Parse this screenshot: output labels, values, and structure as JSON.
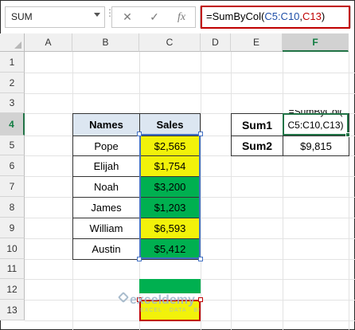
{
  "formula_bar": {
    "name_box": "SUM",
    "cancel_glyph": "✕",
    "enter_glyph": "✓",
    "fx_glyph": "fx",
    "formula_prefix": "=SumByCol(",
    "formula_ref1": "C5:C10",
    "formula_comma": ",",
    "formula_ref2": "C13",
    "formula_suffix": ")"
  },
  "columns": [
    "A",
    "B",
    "C",
    "D",
    "E",
    "F"
  ],
  "rows": [
    "1",
    "2",
    "3",
    "4",
    "5",
    "6",
    "7",
    "8",
    "9",
    "10",
    "11",
    "12",
    "13"
  ],
  "table": {
    "header_names": "Names",
    "header_sales": "Sales",
    "rows": [
      {
        "name": "Pope",
        "sales": "$2,565",
        "color": "#f2f20a"
      },
      {
        "name": "Elijah",
        "sales": "$1,754",
        "color": "#f2f20a"
      },
      {
        "name": "Noah",
        "sales": "$3,200",
        "color": "#00b050"
      },
      {
        "name": "James",
        "sales": "$1,203",
        "color": "#00b050"
      },
      {
        "name": "William",
        "sales": "$6,593",
        "color": "#f2f20a"
      },
      {
        "name": "Austin",
        "sales": "$5,412",
        "color": "#00b050"
      }
    ]
  },
  "summary": {
    "sum1_label": "Sum1",
    "sum1_value_line1": "=SumByCol(",
    "sum1_value_line2": "C5:C10,C13)",
    "sum2_label": "Sum2",
    "sum2_value": "$9,815"
  },
  "watermark": {
    "name": "exceldemy",
    "sub": "EXCEL · DATA · BI"
  },
  "colors": {
    "yellow": "#f2f20a",
    "green": "#00b050",
    "header_fill": "#dce6f1",
    "formula_highlight": "#c00000",
    "ref_blue": "#1f4fa8"
  }
}
